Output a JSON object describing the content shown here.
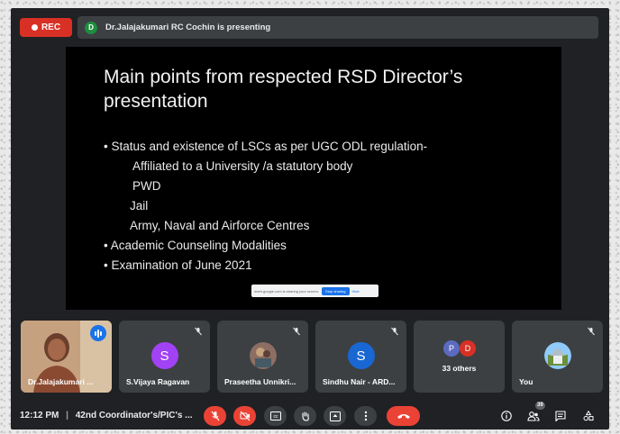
{
  "topbar": {
    "rec_label": "REC",
    "presenter_initial": "D",
    "presenting_text": "Dr.Jalajakumari RC Cochin is presenting"
  },
  "slide": {
    "title": "Main points from respected RSD Director’s presentation",
    "lines": [
      "• Status and existence of LSCs as per UGC ODL regulation-",
      "Affiliated to a University /a statutory body",
      "PWD",
      "Jail",
      "Army, Naval and Airforce Centres",
      "• Academic Counseling Modalities",
      "• Examination of June 2021"
    ],
    "share_bar": {
      "text": "meet.google.com is sharing your screen.",
      "stop_label": "Stop sharing",
      "hide_label": "Hide"
    }
  },
  "participants": [
    {
      "name": "Dr.Jalajakumari ...",
      "initial": "",
      "color": "",
      "speaking": true
    },
    {
      "name": "S.Vijaya Ragavan",
      "initial": "S",
      "color": "#a142f4",
      "muted": true
    },
    {
      "name": "Praseetha Unnikri...",
      "initial": "",
      "color": "",
      "muted": true
    },
    {
      "name": "Sindhu Nair - ARD...",
      "initial": "S",
      "color": "#1967d2",
      "muted": true
    },
    {
      "name": "33 others",
      "initials": [
        "P",
        "D"
      ],
      "colors": [
        "#5c6bc0",
        "#d93025"
      ]
    },
    {
      "name": "You",
      "initial": "",
      "color": "",
      "muted": true
    }
  ],
  "bottombar": {
    "time": "12:12 PM",
    "separator": "|",
    "meeting_title": "42nd Coordinator's/PIC's ...",
    "people_count": "39",
    "icons": [
      "mic-off-icon",
      "camera-off-icon",
      "captions-icon",
      "raise-hand-icon",
      "present-icon",
      "more-options-icon",
      "leave-call-icon",
      "info-icon",
      "people-icon",
      "chat-icon",
      "activities-icon"
    ]
  },
  "colors": {
    "meet_bg": "#202124",
    "tile_bg": "#3c4043",
    "red": "#ea4335",
    "blue": "#1a73e8"
  }
}
